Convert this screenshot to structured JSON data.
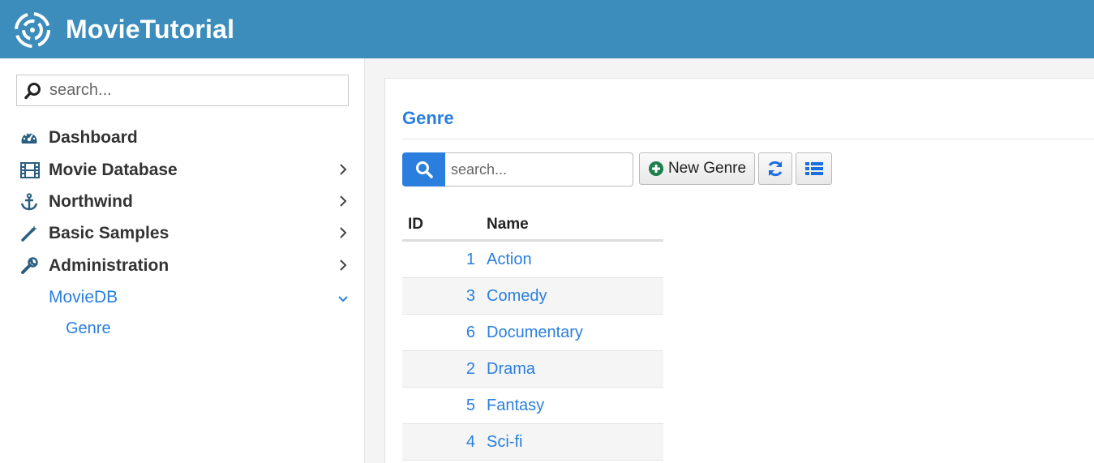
{
  "app": {
    "title": "MovieTutorial"
  },
  "sidebar": {
    "search_placeholder": "search...",
    "items": [
      {
        "label": "Dashboard"
      },
      {
        "label": "Movie Database"
      },
      {
        "label": "Northwind"
      },
      {
        "label": "Basic Samples"
      },
      {
        "label": "Administration"
      },
      {
        "label": "MovieDB"
      }
    ],
    "sub_items": [
      {
        "label": "Genre"
      }
    ]
  },
  "main": {
    "title": "Genre",
    "search_placeholder": "search...",
    "new_button_label": "New Genre",
    "columns": {
      "id": "ID",
      "name": "Name"
    },
    "rows": [
      {
        "id": "1",
        "name": "Action"
      },
      {
        "id": "3",
        "name": "Comedy"
      },
      {
        "id": "6",
        "name": "Documentary"
      },
      {
        "id": "2",
        "name": "Drama"
      },
      {
        "id": "5",
        "name": "Fantasy"
      },
      {
        "id": "4",
        "name": "Sci-fi"
      }
    ]
  },
  "colors": {
    "header": "#3c8dbc",
    "accent": "#2a7fde",
    "new_icon": "#1e7e4e"
  }
}
